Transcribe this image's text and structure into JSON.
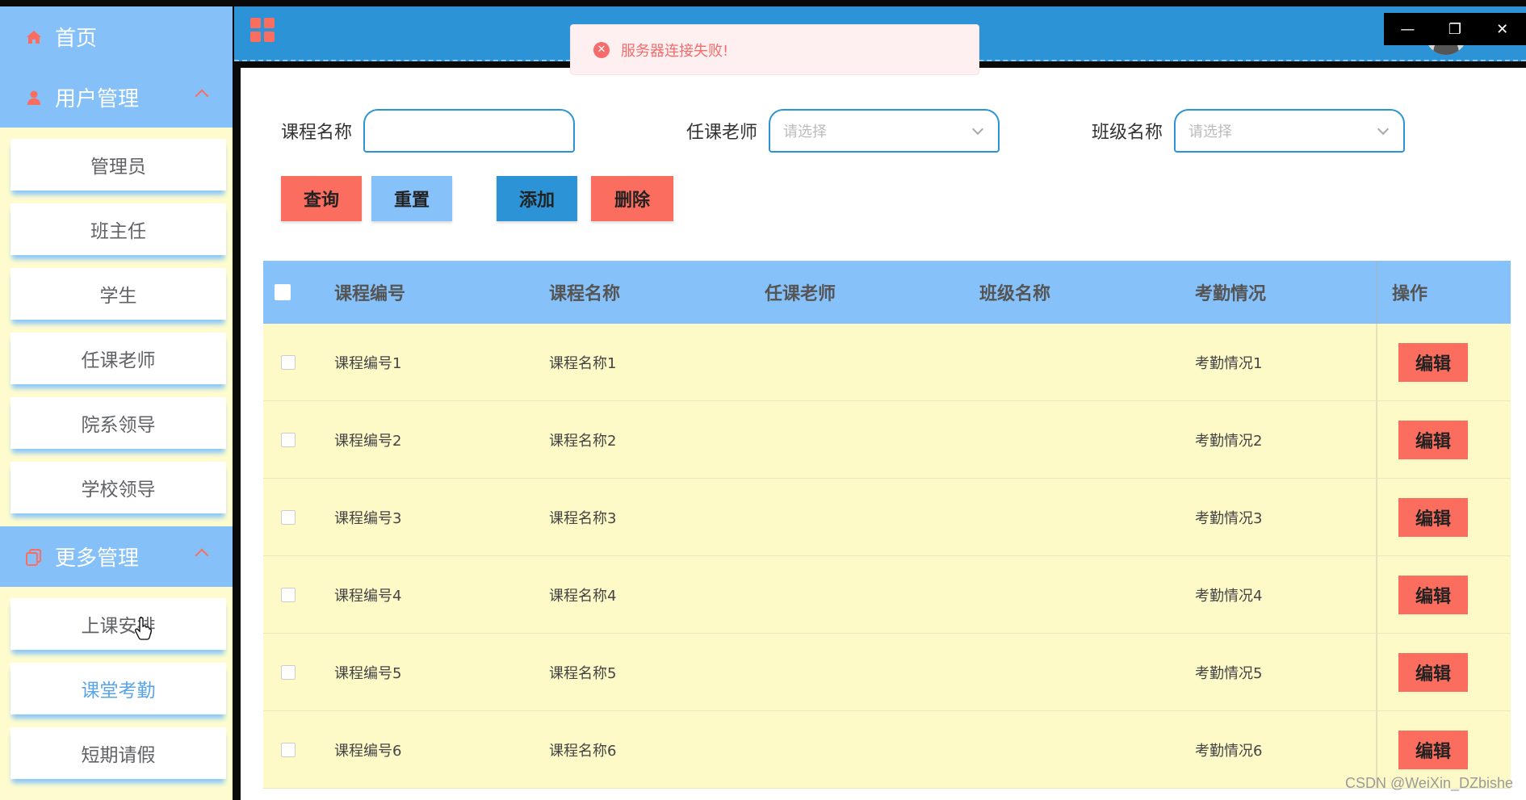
{
  "sidebar": {
    "home_label": "首页",
    "user_mgmt_label": "用户管理",
    "user_items": [
      "管理员",
      "班主任",
      "学生",
      "任课老师",
      "院系领导",
      "学校领导"
    ],
    "more_mgmt_label": "更多管理",
    "more_items": [
      "上课安排",
      "课堂考勤",
      "短期请假"
    ],
    "active_item": "课堂考勤"
  },
  "toast": {
    "message": "服务器连接失败!"
  },
  "filters": {
    "course_name_label": "课程名称",
    "teacher_label": "任课老师",
    "teacher_placeholder": "请选择",
    "class_label": "班级名称",
    "class_placeholder": "请选择"
  },
  "actions": {
    "query": "查询",
    "reset": "重置",
    "add": "添加",
    "delete": "删除"
  },
  "table": {
    "headers": [
      "课程编号",
      "课程名称",
      "任课老师",
      "班级名称",
      "考勤情况",
      "操作"
    ],
    "rows": [
      [
        "课程编号1",
        "课程名称1",
        "",
        "",
        "考勤情况1"
      ],
      [
        "课程编号2",
        "课程名称2",
        "",
        "",
        "考勤情况2"
      ],
      [
        "课程编号3",
        "课程名称3",
        "",
        "",
        "考勤情况3"
      ],
      [
        "课程编号4",
        "课程名称4",
        "",
        "",
        "考勤情况4"
      ],
      [
        "课程编号5",
        "课程名称5",
        "",
        "",
        "考勤情况5"
      ],
      [
        "课程编号6",
        "课程名称6",
        "",
        "",
        "考勤情况6"
      ]
    ],
    "edit_label": "编辑"
  },
  "watermark": "CSDN @WeiXin_DZbishe",
  "colors": {
    "accent_blue": "#2b93d6",
    "light_blue": "#86c1f9",
    "red": "#fa6d5f",
    "row_yellow": "#fefac8"
  }
}
